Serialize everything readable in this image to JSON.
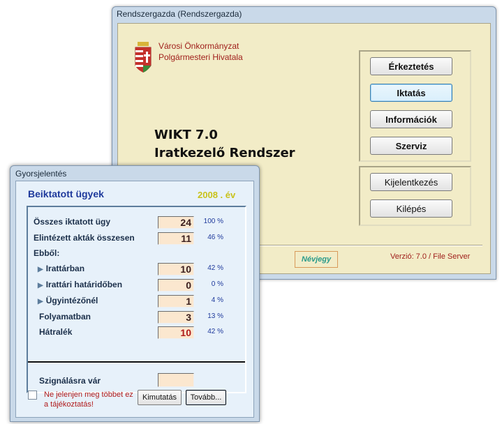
{
  "main_window": {
    "title": "Rendszergazda   (Rendszergazda)",
    "org_line1": "Városi Önkormányzat",
    "org_line2": "Polgármesteri Hivatala",
    "product_line1": "WIKT 7.0",
    "product_line2": "Iratkezelő Rendszer",
    "buttons": {
      "erkeztetes": "Érkeztetés",
      "iktatas": "Iktatás",
      "informaciok": "Információk",
      "szerviz": "Szerviz",
      "kijelentkezes": "Kijelentkezés",
      "kilepes": "Kilépés"
    },
    "about_label": "Névjegy",
    "version": "Verzió: 7.0 / File Server"
  },
  "quick_report": {
    "title": "Gyorsjelentés",
    "header": "Beiktatott ügyek",
    "year": "2008 . év",
    "rows": [
      {
        "label": "Összes iktatott ügy",
        "value": "24",
        "pct": "100 %"
      },
      {
        "label": "Elintézett akták összesen",
        "value": "11",
        "pct": "46 %"
      },
      {
        "label": "Ebből:"
      },
      {
        "label": "Irattárban",
        "value": "10",
        "pct": "42 %"
      },
      {
        "label": "Irattári határidőben",
        "value": "0",
        "pct": "0 %"
      },
      {
        "label": "Ügyintézőnél",
        "value": "1",
        "pct": "4 %"
      },
      {
        "label": "Folyamatban",
        "value": "3",
        "pct": "13 %"
      },
      {
        "label": "Hátralék",
        "value": "10",
        "pct": "42 %"
      }
    ],
    "signal_label": "Szignálásra vár",
    "signal_value": "",
    "checkbox_line1": "Ne jelenjen meg többet ez",
    "checkbox_line2": "a tájékoztatás!",
    "kimutatas_label": "Kimutatás",
    "tovabb_label": "Tovább..."
  },
  "colors": {
    "main_client_bg": "#f2ecc7",
    "report_bg": "#e7f1fa",
    "value_box_bg": "#fbe7cf",
    "accent_red": "#a0201c",
    "accent_blue": "#1f3a9c"
  }
}
